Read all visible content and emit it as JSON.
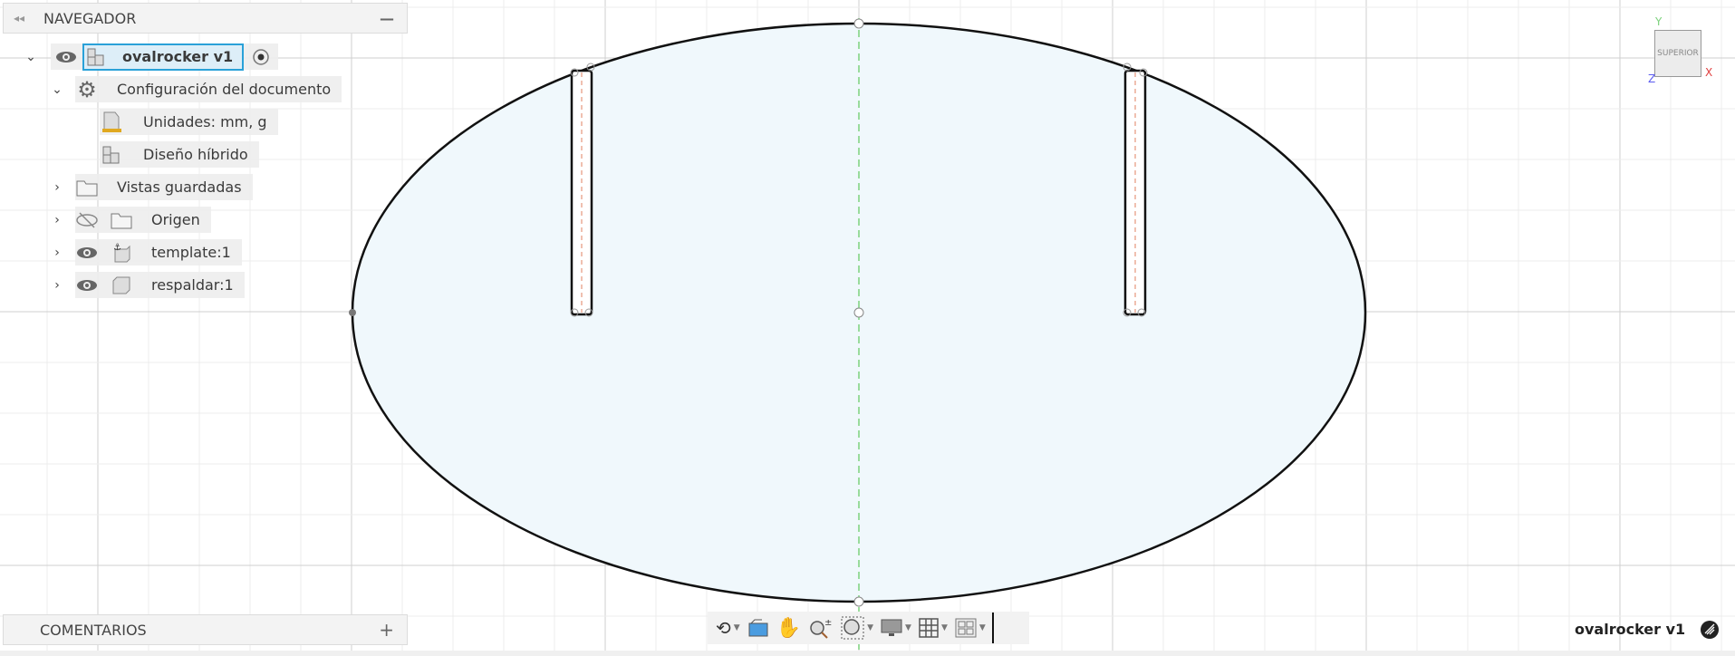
{
  "navigator": {
    "title": "NAVEGADOR",
    "collapse_icon": "double-chevron-left",
    "minimize_icon": "minus"
  },
  "tree": {
    "root": {
      "label": "ovalrocker v1"
    },
    "items": [
      {
        "label": "Configuración del documento"
      },
      {
        "label": "Unidades: mm, g"
      },
      {
        "label": "Diseño híbrido"
      },
      {
        "label": "Vistas guardadas"
      },
      {
        "label": "Origen"
      },
      {
        "label": "template:1"
      },
      {
        "label": "respaldar:1"
      }
    ]
  },
  "comments": {
    "title": "COMENTARIOS",
    "add_icon": "plus"
  },
  "viewcube": {
    "face": "SUPERIOR",
    "axes": {
      "x": "X",
      "y": "Y",
      "z": "Z"
    }
  },
  "status": {
    "document_name": "ovalrocker v1"
  },
  "colors": {
    "profile_fill": "#f0f8fc",
    "selection": "#2aa1d8",
    "axis_green": "#7cd17c",
    "axis_red": "#e04040",
    "axis_blue": "#5b5bf0"
  }
}
